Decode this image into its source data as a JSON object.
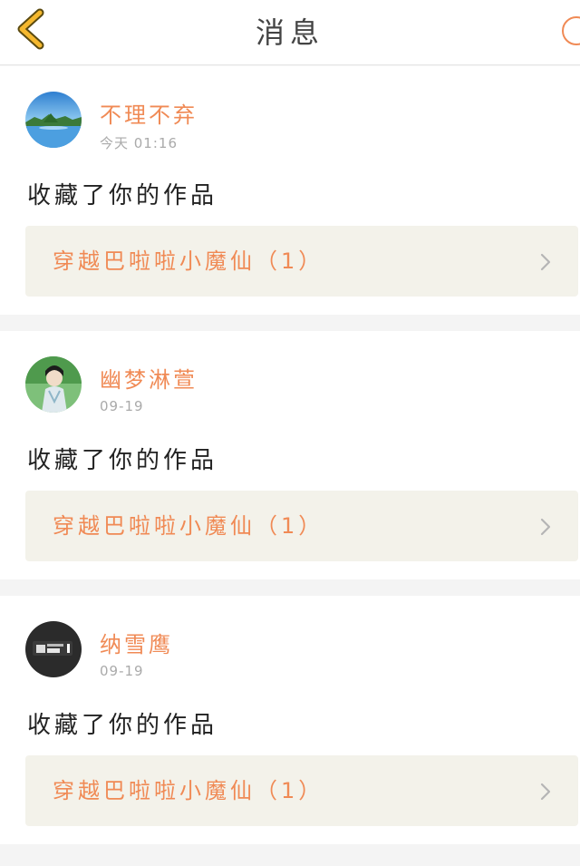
{
  "header": {
    "title": "消息",
    "back_icon": "chevron-left-icon",
    "right_icon": "circle-icon",
    "accent": "#f5b82e"
  },
  "messages": [
    {
      "username": "不理不弃",
      "time": "今天 01:16",
      "action": "收藏了你的作品",
      "work_title": "穿越巴啦啦小魔仙（1）",
      "avatar": "landscape-avatar"
    },
    {
      "username": "幽梦淋萱",
      "time": "09-19",
      "action": "收藏了你的作品",
      "work_title": "穿越巴啦啦小魔仙（1）",
      "avatar": "illustration-avatar"
    },
    {
      "username": "纳雪鹰",
      "time": "09-19",
      "action": "收藏了你的作品",
      "work_title": "穿越巴啦啦小魔仙（1）",
      "avatar": "dark-text-avatar"
    }
  ],
  "colors": {
    "username": "#f08a55",
    "work_title": "#f08a55",
    "work_bg": "#f3f2ea",
    "page_bg": "#f4f4f4"
  }
}
